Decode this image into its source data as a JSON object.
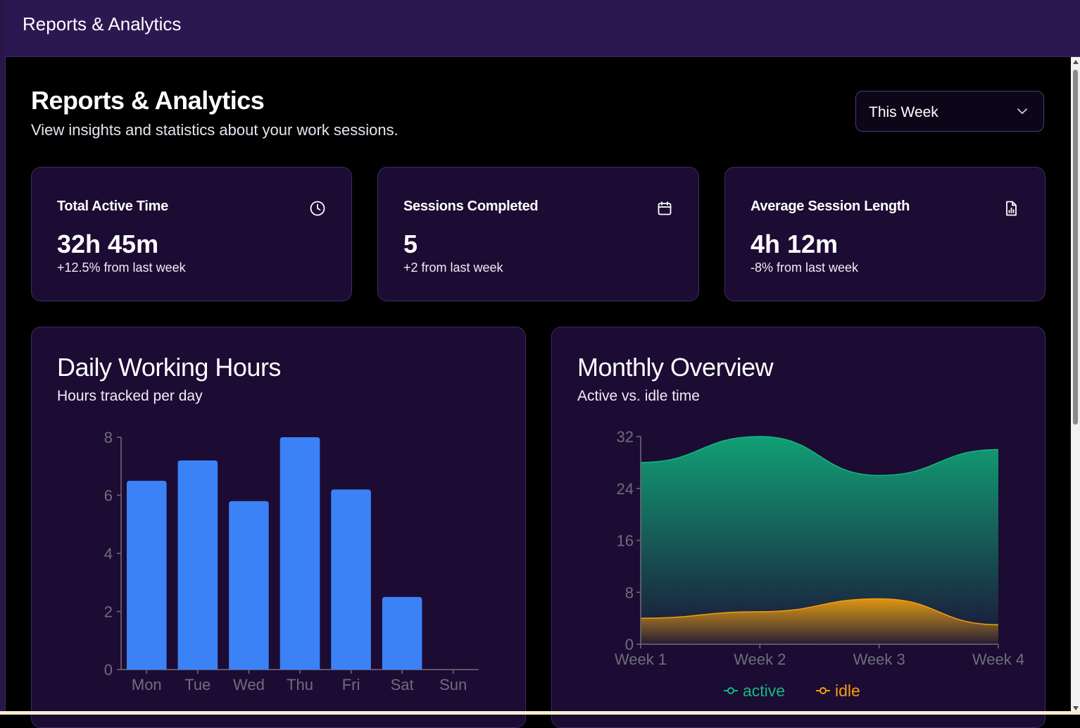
{
  "window": {
    "title": "Reports & Analytics"
  },
  "header": {
    "title": "Reports & Analytics",
    "subtitle": "View insights and statistics about your work sessions."
  },
  "period_select": {
    "value": "This Week"
  },
  "stats": [
    {
      "label": "Total Active Time",
      "value": "32h 45m",
      "delta": "+12.5% from last week",
      "icon": "clock-icon"
    },
    {
      "label": "Sessions Completed",
      "value": "5",
      "delta": "+2 from last week",
      "icon": "calendar-icon"
    },
    {
      "label": "Average Session Length",
      "value": "4h 12m",
      "delta": "-8% from last week",
      "icon": "file-chart-icon"
    }
  ],
  "colors": {
    "bar": "#3b82f6",
    "active": "#10b981",
    "idle": "#f59e0b",
    "card_bg": "#1c0b33",
    "topbar": "#2c1750"
  },
  "daily_chart": {
    "title": "Daily Working Hours",
    "subtitle": "Hours tracked per day"
  },
  "monthly_chart": {
    "title": "Monthly Overview",
    "subtitle": "Active vs. idle time"
  },
  "chart_data": [
    {
      "type": "bar",
      "title": "Daily Working Hours",
      "categories": [
        "Mon",
        "Tue",
        "Wed",
        "Thu",
        "Fri",
        "Sat",
        "Sun"
      ],
      "values": [
        6.5,
        7.2,
        5.8,
        8.0,
        6.2,
        2.5,
        0
      ],
      "ylim": [
        0,
        8
      ],
      "yticks": [
        0,
        2,
        4,
        6,
        8
      ],
      "grid": false
    },
    {
      "type": "area",
      "title": "Monthly Overview",
      "categories": [
        "Week 1",
        "Week 2",
        "Week 3",
        "Week 4"
      ],
      "series": [
        {
          "name": "active",
          "values": [
            28,
            32,
            26,
            30
          ]
        },
        {
          "name": "idle",
          "values": [
            4,
            5,
            7,
            3
          ]
        }
      ],
      "ylim": [
        0,
        32
      ],
      "yticks": [
        0,
        8,
        16,
        24,
        32
      ],
      "legend": "bottom",
      "grid": false
    }
  ]
}
